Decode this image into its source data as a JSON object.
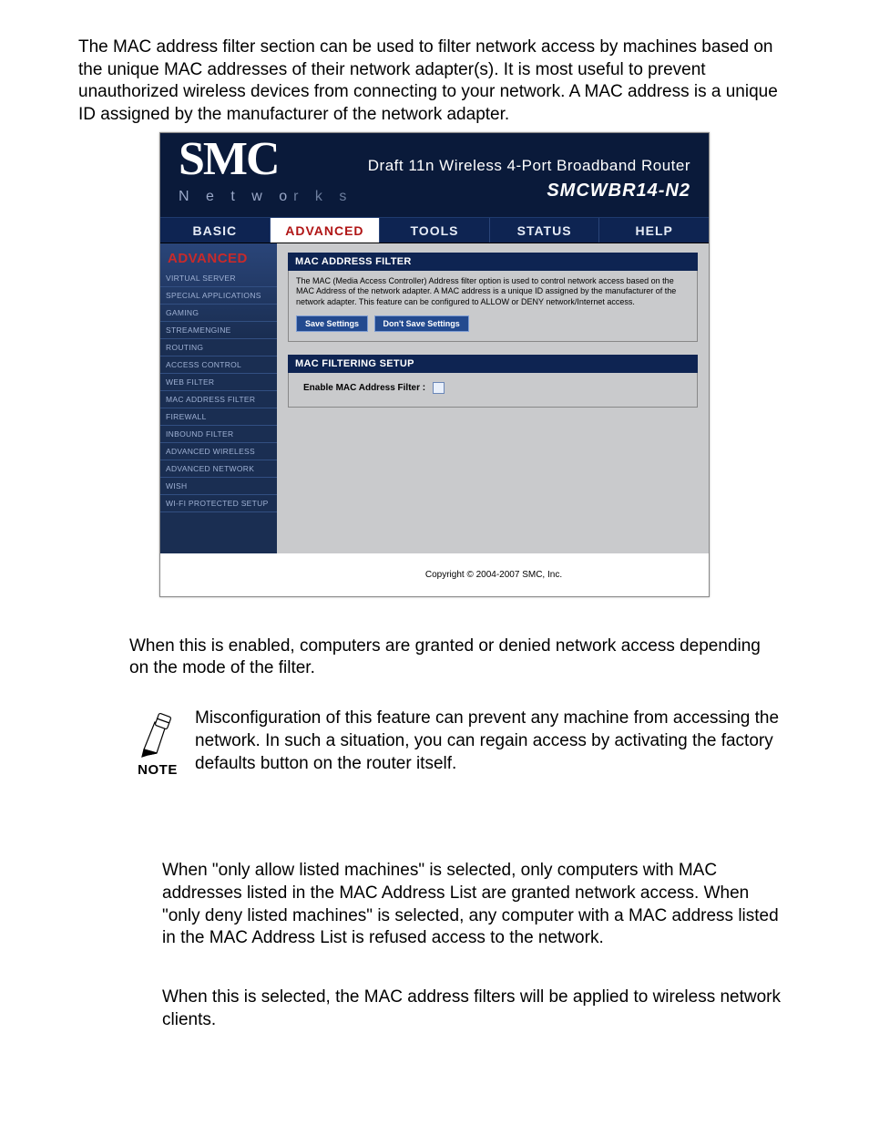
{
  "intro": "The MAC address filter section can be used to filter network access by machines based on the unique MAC addresses of their network adapter(s). It is most useful to prevent unauthorized wireless devices from connecting to your network. A MAC address is a unique ID assigned by the manufacturer of the network adapter.",
  "router": {
    "logo_big": "SMC",
    "logo_net_light": "N e t w o",
    "logo_net_dark": "r k s",
    "title1": "Draft 11n Wireless 4-Port Broadband Router",
    "title2": "SMCWBR14-N2",
    "nav": {
      "basic": "BASIC",
      "advanced": "ADVANCED",
      "tools": "TOOLS",
      "status": "STATUS",
      "help": "HELP"
    },
    "sidebar": {
      "head": "ADVANCED",
      "items": [
        "VIRTUAL SERVER",
        "SPECIAL APPLICATIONS",
        "GAMING",
        "STREAMENGINE",
        "ROUTING",
        "ACCESS CONTROL",
        "WEB FILTER",
        "MAC ADDRESS FILTER",
        "FIREWALL",
        "INBOUND FILTER",
        "ADVANCED WIRELESS",
        "ADVANCED NETWORK",
        "WISH",
        "WI-FI PROTECTED SETUP"
      ]
    },
    "content": {
      "sec1_title": "MAC ADDRESS FILTER",
      "sec1_desc": "The MAC (Media Access Controller) Address filter option is used to control network access based on the MAC Address of the network adapter. A MAC address is a unique ID assigned by the manufacturer of the network adapter. This feature can be configured to ALLOW or DENY network/Internet access.",
      "btn_save": "Save Settings",
      "btn_dont": "Don't Save Settings",
      "sec2_title": "MAC FILTERING SETUP",
      "sec2_label": "Enable MAC Address Filter :"
    },
    "copyright": "Copyright © 2004-2007 SMC, Inc."
  },
  "para_enable": "When this is enabled, computers are granted or denied network access depending on the mode of the filter.",
  "note_label": "NOTE",
  "note_text": "Misconfiguration of this feature can prevent any machine from accessing the network. In such a situation, you can regain access by activating the factory defaults button on the router itself.",
  "para_allow": "When \"only allow listed machines\" is selected, only computers with MAC addresses listed in the MAC Address List are granted network access. When \"only deny listed machines\" is selected, any computer with a MAC address listed in the MAC Address List is refused access to the network.",
  "para_wireless": "When this is selected, the MAC address filters will be applied to wireless network clients."
}
